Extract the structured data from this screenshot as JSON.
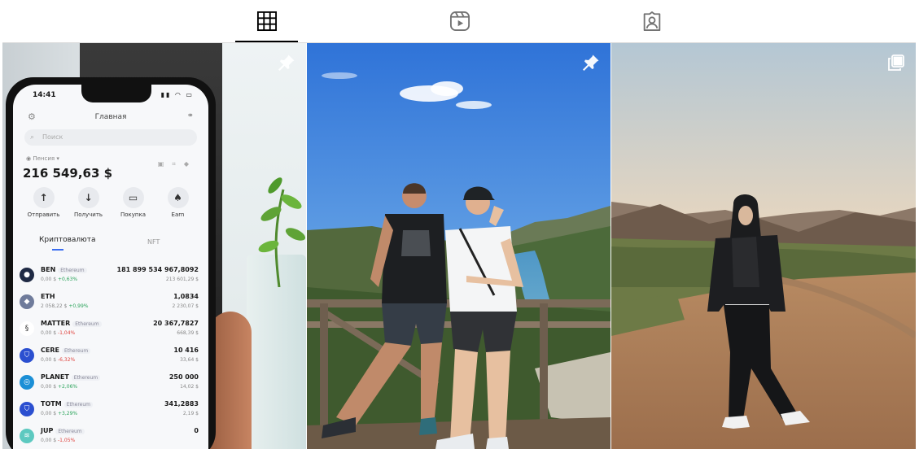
{
  "tabs": [
    {
      "name": "posts",
      "icon": "grid-icon",
      "active": true
    },
    {
      "name": "reels",
      "icon": "reels-icon",
      "active": false
    },
    {
      "name": "tagged",
      "icon": "tagged-user-icon",
      "active": false
    }
  ],
  "posts": [
    {
      "badge_icon": "pin-icon",
      "phone_screen": {
        "status_time": "14:41",
        "title": "Главная",
        "search_placeholder": "Поиск",
        "account_label": "Пенсия",
        "balance": "216 549,63 $",
        "actions": [
          "Отправить",
          "Получить",
          "Покупка",
          "Earn"
        ],
        "tabs": [
          "Криптовалюта",
          "NFT"
        ],
        "tokens": [
          {
            "symbol": "BEN",
            "network": "Ethereum",
            "price": "0,00 $",
            "change": "+0,63%",
            "amount": "181 899 534 967,8092",
            "fiat": "213 601,29 $"
          },
          {
            "symbol": "ETH",
            "network": "",
            "price": "2 058,22 $",
            "change": "+0,99%",
            "amount": "1,0834",
            "fiat": "2 230,07 $"
          },
          {
            "symbol": "MATTER",
            "network": "Ethereum",
            "price": "0,00 $",
            "change": "-1,04%",
            "amount": "20 367,7827",
            "fiat": "668,39 $"
          },
          {
            "symbol": "CERE",
            "network": "Ethereum",
            "price": "0,00 $",
            "change": "-6,32%",
            "amount": "10 416",
            "fiat": "33,64 $"
          },
          {
            "symbol": "PLANET",
            "network": "Ethereum",
            "price": "0,00 $",
            "change": "+2,06%",
            "amount": "250 000",
            "fiat": "14,02 $"
          },
          {
            "symbol": "TOTM",
            "network": "Ethereum",
            "price": "0,00 $",
            "change": "+3,29%",
            "amount": "341,2883",
            "fiat": "2,19 $"
          },
          {
            "symbol": "JUP",
            "network": "Ethereum",
            "price": "0,00 $",
            "change": "-1,05%",
            "amount": "0",
            "fiat": ""
          }
        ]
      }
    },
    {
      "badge_icon": "pin-icon"
    },
    {
      "badge_icon": "carousel-icon"
    }
  ],
  "colors": {
    "tab_active": "#000000",
    "tab_icon": "#737373",
    "divider": "#dbdbdb"
  }
}
